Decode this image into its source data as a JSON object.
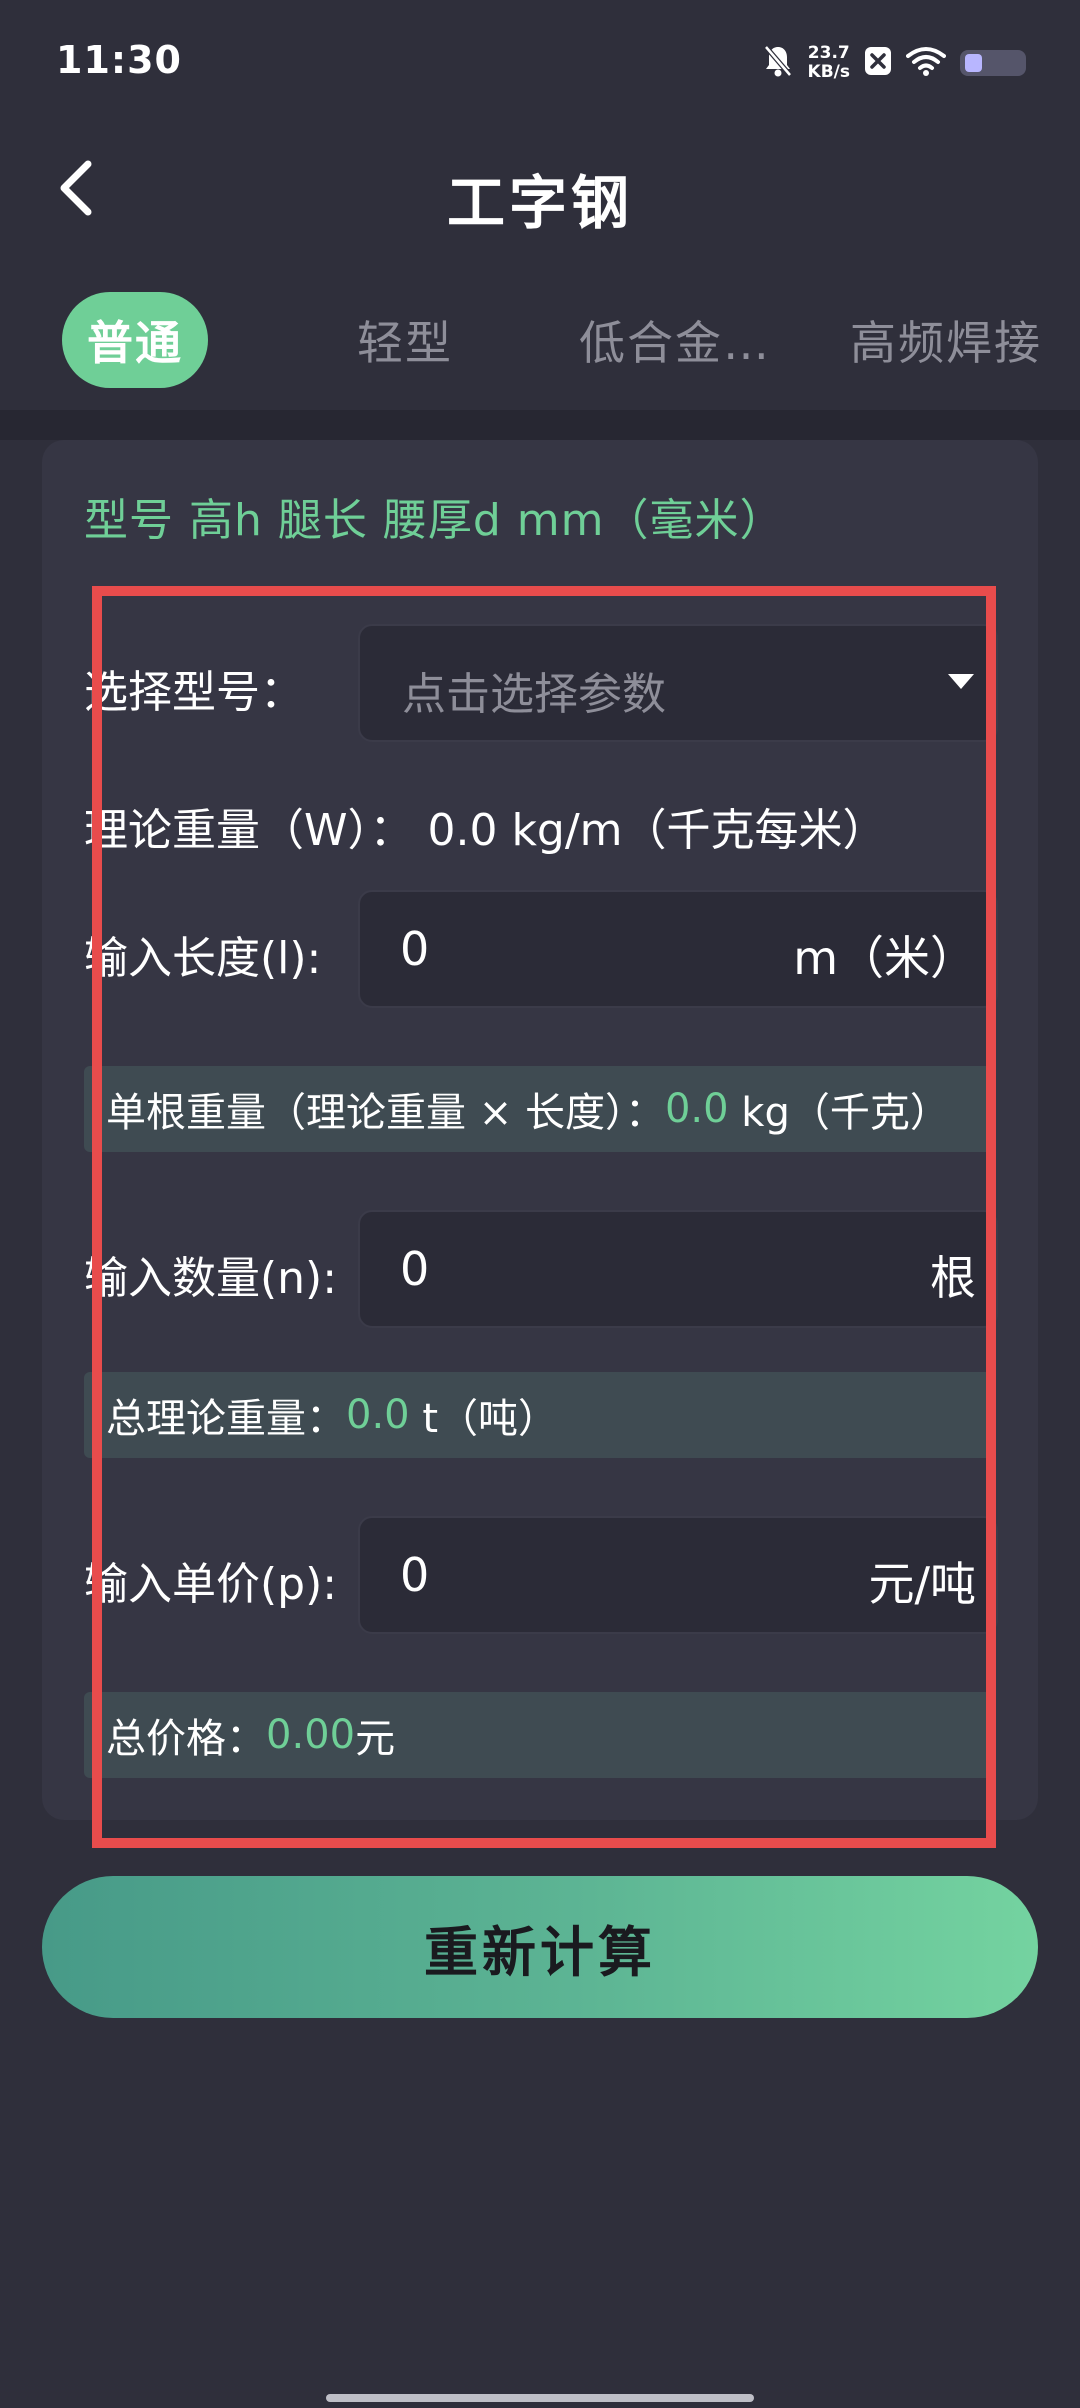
{
  "status_bar": {
    "time": "11:30",
    "net_speed_value": "23.7",
    "net_speed_unit": "KB/s",
    "battery_level_percent": 30,
    "icons": [
      "bell-off-icon",
      "close-badge-icon",
      "wifi-icon",
      "battery-icon"
    ]
  },
  "header": {
    "title": "工字钢",
    "back_icon": "chevron-left-icon"
  },
  "tabs": [
    {
      "label": "普通",
      "active": true
    },
    {
      "label": "轻型",
      "active": false
    },
    {
      "label": "低合金…",
      "active": false
    },
    {
      "label": "高频焊接",
      "active": false
    }
  ],
  "spec_title": "型号 高h 腿长 腰厚d mm（毫米）",
  "form": {
    "model_label": "选择型号：",
    "model_placeholder": "点击选择参数",
    "theory_weight_text": "理论重量（W）：  0.0 kg/m（千克每米）",
    "length_label": "输入长度(l):",
    "length_value": "0",
    "length_unit": "m（米）",
    "single_weight_prefix": "单根重量（理论重量 × 长度）：",
    "single_weight_value": "0.0",
    "single_weight_suffix": " kg（千克）",
    "quantity_label": "输入数量(n):",
    "quantity_value": "0",
    "quantity_unit": "根",
    "total_weight_prefix": "总理论重量：",
    "total_weight_value": "0.0",
    "total_weight_suffix": " t（吨）",
    "price_label": "输入单价(p):",
    "price_value": "0",
    "price_unit": "元/吨",
    "total_price_prefix": "总价格：",
    "total_price_value": "0.00",
    "total_price_suffix": "元"
  },
  "recalculate_label": "重新计算",
  "colors": {
    "accent": "#6fcf97",
    "background": "#2f2f3b",
    "card": "#363644",
    "highlight": "#e84c4c"
  }
}
